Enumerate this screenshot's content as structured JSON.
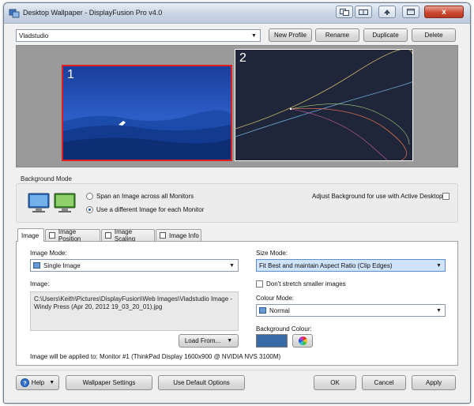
{
  "window": {
    "title": "Desktop Wallpaper - DisplayFusion Pro v4.0",
    "close_glyph": "x"
  },
  "profile": {
    "selected": "Vladstudio",
    "buttons": {
      "new": "New Profile",
      "rename": "Rename",
      "duplicate": "Duplicate",
      "delete": "Delete"
    }
  },
  "monitors": [
    {
      "number": "1",
      "selected": true
    },
    {
      "number": "2",
      "selected": false
    }
  ],
  "background_mode": {
    "group_label": "Background Mode",
    "options": [
      {
        "label": "Span an Image across all Monitors",
        "selected": false
      },
      {
        "label": "Use a different Image for each Monitor",
        "selected": true
      }
    ],
    "active_desktop_label": "Adjust Background for use with Active Desktop",
    "active_desktop_checked": false
  },
  "tabs": [
    {
      "label": "Image",
      "active": true,
      "has_check": false
    },
    {
      "label": "Image Position",
      "active": false,
      "has_check": true
    },
    {
      "label": "Image Scaling",
      "active": false,
      "has_check": true
    },
    {
      "label": "Image Info",
      "active": false,
      "has_check": true
    }
  ],
  "image_tab": {
    "image_mode_label": "Image Mode:",
    "image_mode_value": "Single Image",
    "image_label": "Image:",
    "image_path": "C:\\Users\\Keith\\Pictures\\DisplayFusion\\Web Images\\Vladstudio Image - Windy Press (Apr 20, 2012 19_03_20_01).jpg",
    "load_from_label": "Load From...",
    "size_mode_label": "Size Mode:",
    "size_mode_value": "Fit Best and maintain Aspect Ratio (Clip Edges)",
    "dont_stretch_label": "Don't stretch smaller images",
    "dont_stretch_checked": false,
    "colour_mode_label": "Colour Mode:",
    "colour_mode_value": "Normal",
    "background_colour_label": "Background Colour:",
    "background_colour": "#3a6aa6",
    "applied_to": "Image will be applied to: Monitor #1 (ThinkPad Display 1600x900 @ NVIDIA NVS 3100M)"
  },
  "footer": {
    "help": "Help",
    "wallpaper_settings": "Wallpaper Settings",
    "use_default": "Use Default Options",
    "ok": "OK",
    "cancel": "Cancel",
    "apply": "Apply"
  },
  "colors": {
    "selection_accent": "#e02020",
    "monitor_frame": "#ffffff",
    "desktop_preview_bg": "#9a9a9a"
  }
}
